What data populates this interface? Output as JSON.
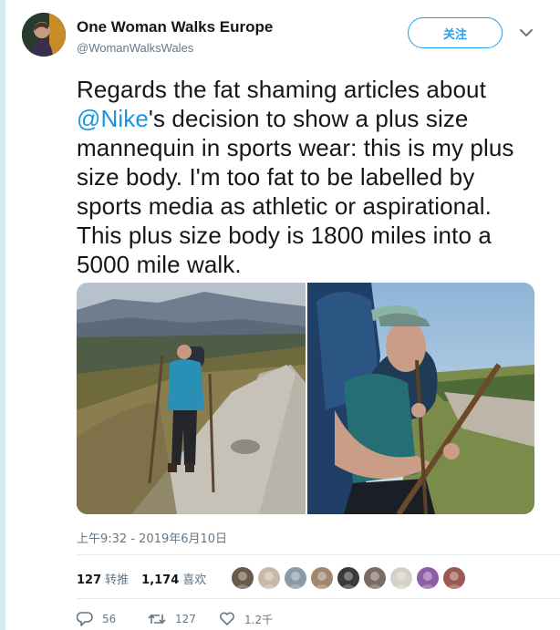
{
  "author": {
    "display_name": "One Woman Walks Europe",
    "handle": "@WomanWalksWales"
  },
  "follow_label": "关注",
  "tweet": {
    "text_before": "Regards the fat shaming articles about ",
    "mention": "@Nike",
    "text_after": "'s decision to show a plus size mannequin in sports wear: this is my plus size body. I'm too fat to be labelled by sports media as athletic or aspirational. This plus size body is 1800 miles into a 5000 mile walk."
  },
  "timestamp": "上午9:32 - 2019年6月10日",
  "stats": {
    "retweets_count": "127",
    "retweets_label": "转推",
    "likes_count": "1,174",
    "likes_label": "喜欢"
  },
  "actions": {
    "reply_count": "56",
    "retweet_count": "127",
    "like_count": "1.2千"
  },
  "likers": [
    {
      "color": "#6b5a4a"
    },
    {
      "color": "#c9b8a8"
    },
    {
      "color": "#8a9aa6"
    },
    {
      "color": "#a3866d"
    },
    {
      "color": "#3a3a3a"
    },
    {
      "color": "#7b6b63"
    },
    {
      "color": "#d5d0c8"
    },
    {
      "color": "#8f5ea8"
    },
    {
      "color": "#9a5a52"
    }
  ],
  "colors": {
    "accent": "#1da1f2",
    "mention": "#1b95e0",
    "muted": "#657786"
  }
}
